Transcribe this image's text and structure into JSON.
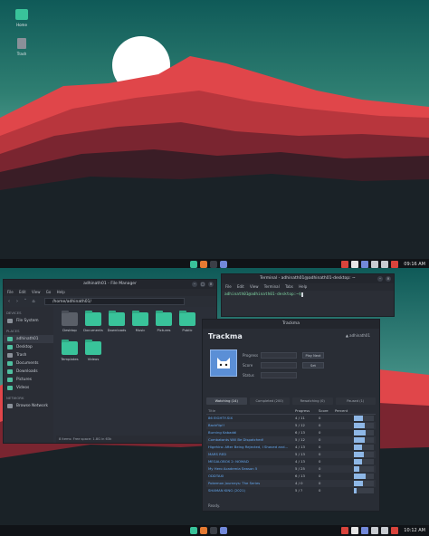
{
  "desktop": {
    "icons": [
      {
        "label": "Home",
        "icon": "home-folder-icon"
      },
      {
        "label": "Trash",
        "icon": "trash-icon"
      }
    ]
  },
  "panel_top": {
    "clock": "09:16 AM"
  },
  "panel_bottom": {
    "clock": "10:12 AM"
  },
  "colors": {
    "accent": "#39c39a",
    "sun": "#ffffff",
    "mountain_red": "#e0464a",
    "sky_top": "#0f5a58",
    "sky_bottom": "#5ca89a"
  },
  "file_manager": {
    "title": "adhinath01 - File Manager",
    "path": "/home/adhinath01/",
    "sidebar": {
      "devices_header": "DEVICES",
      "devices": [
        "File System"
      ],
      "places_header": "PLACES",
      "places": [
        "adhinath01",
        "Desktop",
        "Trash",
        "Documents",
        "Downloads",
        "Pictures",
        "Videos"
      ],
      "network_header": "NETWORK",
      "network": [
        "Browse Network"
      ]
    },
    "files": [
      "Desktop",
      "Documents",
      "Downloads",
      "Music",
      "Pictures",
      "Public",
      "Templates",
      "Videos"
    ],
    "status": "8 items: Free space: 1.8G in 63k"
  },
  "terminal": {
    "title": "Terminal - adhinath01@adhinath01-desktop: ~",
    "menu": [
      "File",
      "Edit",
      "View",
      "Terminal",
      "Tabs",
      "Help"
    ],
    "prompt": "adhinath01@adhinath01-desktop:~$"
  },
  "trackma": {
    "window_title": "Trackma",
    "heading": "Trackma",
    "user": "adhinath01",
    "form": {
      "progress_label": "Progress",
      "score_label": "Score",
      "status_label": "Status",
      "play_button": "Play Next",
      "set_button": "Set"
    },
    "tabs": [
      "Watching (14)",
      "Completed (200)",
      "Rewatching (0)",
      "Paused (1)"
    ],
    "columns": [
      "Title",
      "Progress",
      "Score",
      "Percent"
    ],
    "rows": [
      {
        "title": "86 EIGHTY-SIX",
        "progress": "4 / 11",
        "score": "0",
        "percent": 0.36
      },
      {
        "title": "Backflip!!",
        "progress": "5 / 12",
        "score": "0",
        "percent": 0.42
      },
      {
        "title": "Burning Kabaddi",
        "progress": "6 / 13",
        "score": "0",
        "percent": 0.46
      },
      {
        "title": "Combatants Will Be Dispatched!",
        "progress": "5 / 12",
        "score": "0",
        "percent": 0.42
      },
      {
        "title": "Higehiro: After Being Rejected, I Shaved and...",
        "progress": "4 / 13",
        "score": "0",
        "percent": 0.31
      },
      {
        "title": "MARS RED",
        "progress": "5 / 13",
        "score": "0",
        "percent": 0.38
      },
      {
        "title": "MEGALOBOX 2: NOMAD",
        "progress": "4 / 13",
        "score": "0",
        "percent": 0.31
      },
      {
        "title": "My Hero Academia Season 5",
        "progress": "5 / 25",
        "score": "0",
        "percent": 0.2
      },
      {
        "title": "ODDTAXI",
        "progress": "6 / 13",
        "score": "0",
        "percent": 0.46
      },
      {
        "title": "Pokemon Journeys: The Series",
        "progress": "4 / 0",
        "score": "0",
        "percent": 0.35
      },
      {
        "title": "SHAMAN KING (2021)",
        "progress": "5 / ?",
        "score": "0",
        "percent": 0.1
      }
    ],
    "status": "Ready."
  }
}
